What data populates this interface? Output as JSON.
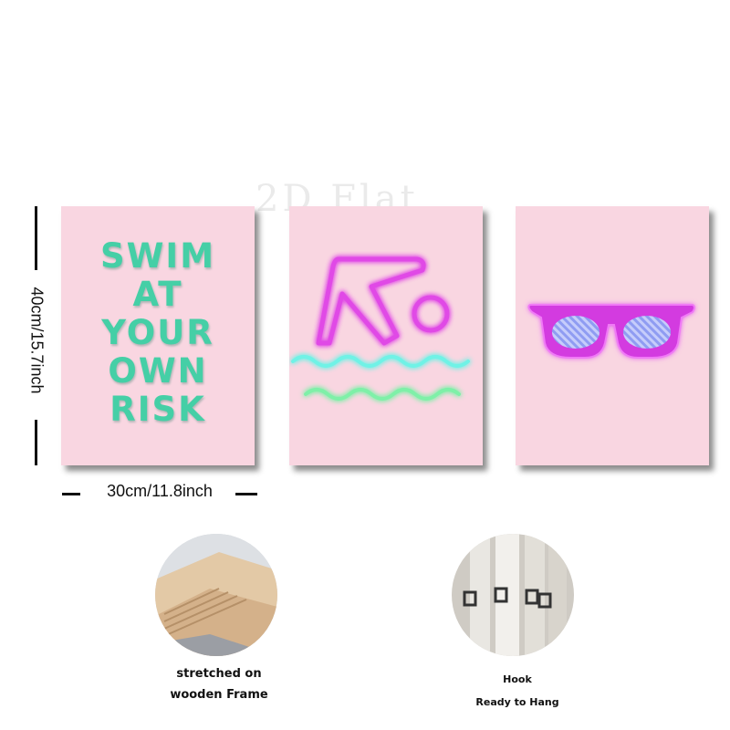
{
  "watermark": "2D Flat",
  "poster1": {
    "lines": [
      "SWIM",
      "AT",
      "YOUR",
      "OWN",
      "RISK"
    ]
  },
  "dimensions": {
    "height": "40cm/15.7inch",
    "width": "30cm/11.8inch"
  },
  "features": [
    {
      "line1": "stretched on",
      "line2": "wooden Frame"
    },
    {
      "line1": "Hook",
      "line2": "Ready to Hang"
    }
  ],
  "colors": {
    "panel": "#f9d6e1",
    "text": "#45cfa6",
    "neon_pink": "#e04ae6",
    "neon_cyan": "#6ff2e6",
    "neon_green": "#7ff0a8"
  },
  "icons": [
    "swimmer-neon-icon",
    "sunglasses-neon-icon"
  ]
}
